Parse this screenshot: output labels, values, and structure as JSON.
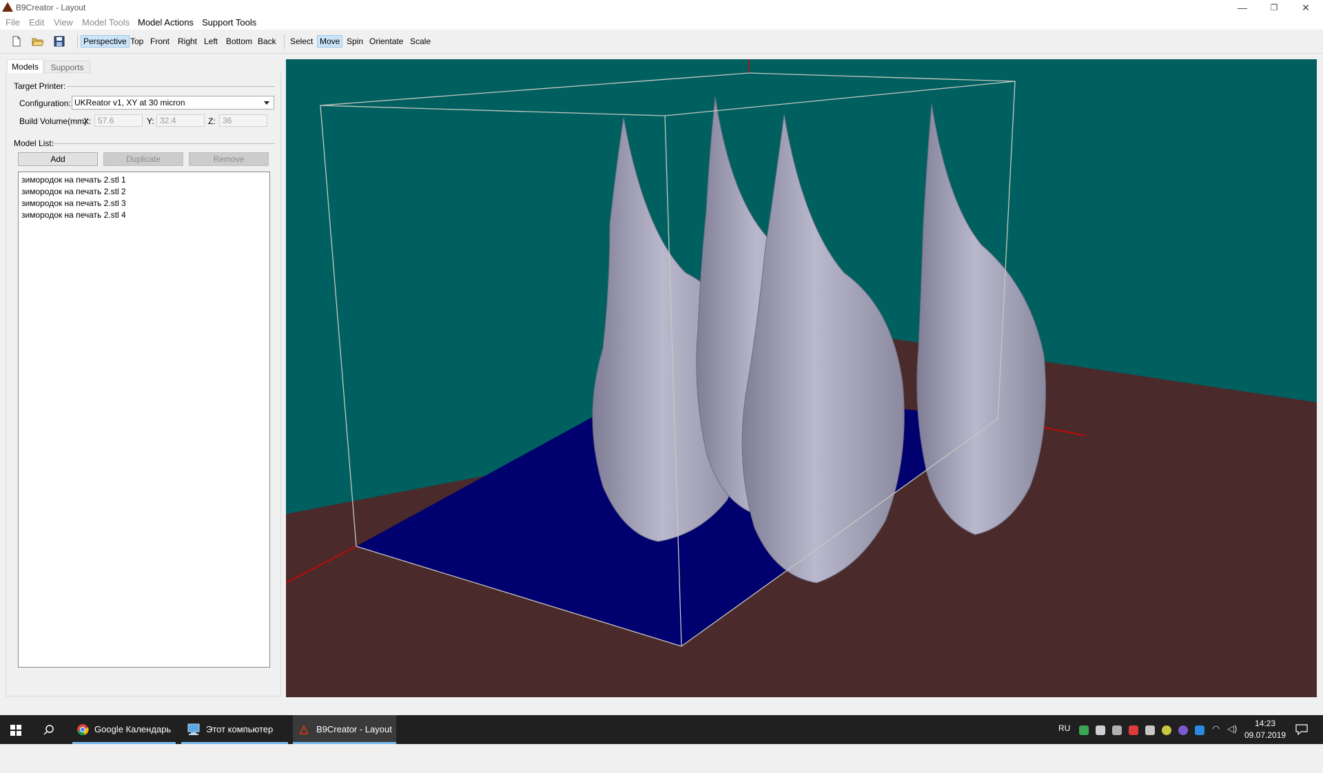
{
  "window": {
    "title": "B9Creator - Layout",
    "minimize": "—",
    "restore": "❐",
    "close": "✕"
  },
  "menu": {
    "items": [
      {
        "label": "File",
        "enabled": false
      },
      {
        "label": "Edit",
        "enabled": false
      },
      {
        "label": "View",
        "enabled": false
      },
      {
        "label": "Model Tools",
        "enabled": false
      },
      {
        "label": "Model Actions",
        "enabled": true
      },
      {
        "label": "Support Tools",
        "enabled": true
      }
    ]
  },
  "toolbar": {
    "views": [
      "Perspective",
      "Top",
      "Front",
      "Right",
      "Left",
      "Bottom",
      "Back"
    ],
    "active_view": "Perspective",
    "tools": [
      "Select",
      "Move",
      "Spin",
      "Orientate",
      "Scale"
    ],
    "active_tool": "Move"
  },
  "tabs": [
    "Models",
    "Supports"
  ],
  "panel": {
    "target_printer_label": "Target Printer:",
    "configuration_label": "Configuration:",
    "configuration_value": "UKReator v1, XY at 30 micron",
    "build_volume_label": "Build Volume(mm):",
    "x_label": "X:",
    "x_value": "57.6",
    "y_label": "Y:",
    "y_value": "32.4",
    "z_label": "Z:",
    "z_value": "36",
    "model_list_label": "Model List:",
    "add_button": "Add",
    "duplicate_button": "Duplicate",
    "remove_button": "Remove",
    "models": [
      "зимородок на печать 2.stl 1",
      "зимородок на печать 2.stl 2",
      "зимородок на печать 2.stl 3",
      "зимородок на печать 2.stl 4"
    ]
  },
  "viewport": {
    "background_color": "#006060",
    "floor_color": "#4a2a2a",
    "plate_color": "#00006e",
    "model_color": "#9b9ab0",
    "box_color": "#c8c8c0",
    "axis_color": "#e00000"
  },
  "taskbar": {
    "tasks": [
      {
        "label": "Google Календарь ...",
        "icon": "chrome-icon"
      },
      {
        "label": "Этот компьютер",
        "icon": "computer-icon"
      },
      {
        "label": "B9Creator - Layout",
        "icon": "b9creator-icon"
      }
    ],
    "language": "RU",
    "time": "14:23",
    "date": "09.07.2019"
  }
}
